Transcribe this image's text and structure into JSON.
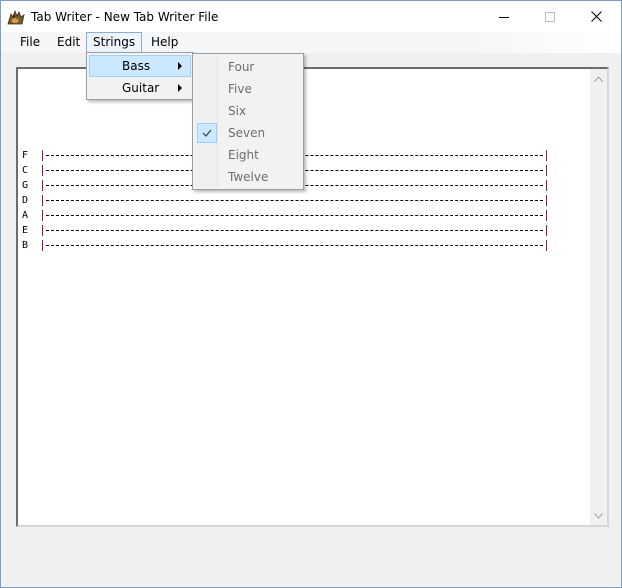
{
  "window": {
    "title": "Tab Writer - New Tab Writer File",
    "icon": "tab-writer-app-icon",
    "controls": [
      "minimize-icon",
      "maximize-icon",
      "close-icon"
    ]
  },
  "menubar": {
    "items": [
      {
        "label": "File"
      },
      {
        "label": "Edit"
      },
      {
        "label": "Strings"
      },
      {
        "label": "Help"
      }
    ],
    "active": "Strings"
  },
  "strings_menu": {
    "items": [
      {
        "label": "Bass",
        "highlighted": true,
        "submenu": true
      },
      {
        "label": "Guitar",
        "highlighted": false,
        "submenu": true
      }
    ]
  },
  "bass_submenu": {
    "items": [
      {
        "label": "Four",
        "checked": false
      },
      {
        "label": "Five",
        "checked": false
      },
      {
        "label": "Six",
        "checked": false
      },
      {
        "label": "Seven",
        "checked": true
      },
      {
        "label": "Eight",
        "checked": false
      },
      {
        "label": "Twelve",
        "checked": false
      }
    ],
    "disabled_text_color": "#6d6d6d"
  },
  "tab_staff": {
    "strings": [
      "F",
      "C",
      "G",
      "D",
      "A",
      "E",
      "B"
    ],
    "bar_color": "#8b1a5a"
  },
  "colors": {
    "menu_highlight": "#cce8ff",
    "menu_highlight_border": "#99d1ff",
    "window_border": "#7a9cc7"
  }
}
